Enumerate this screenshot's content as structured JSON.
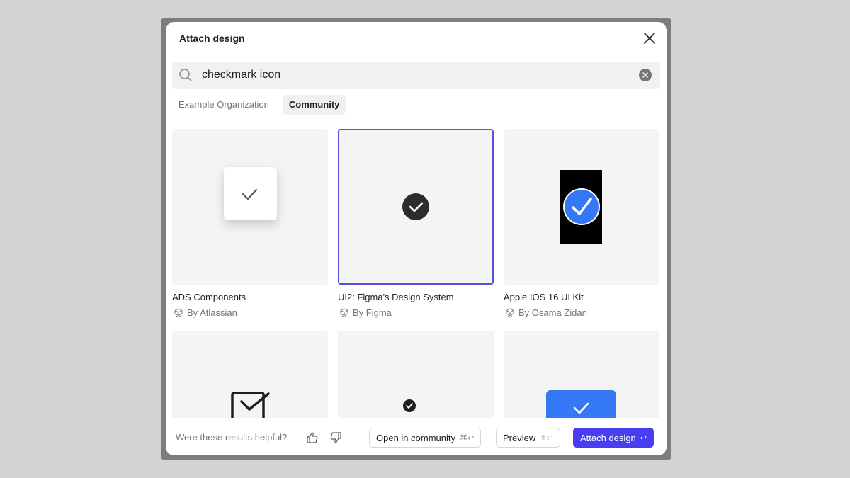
{
  "dialog": {
    "title": "Attach design"
  },
  "search": {
    "value": "checkmark icon",
    "placeholder": "Search"
  },
  "tabs": [
    {
      "label": "Example Organization",
      "active": false
    },
    {
      "label": "Community",
      "active": true
    }
  ],
  "results": [
    {
      "title": "ADS Components",
      "author": "By Atlassian",
      "thumbnail": "white-square-checkmark",
      "selected": false
    },
    {
      "title": "UI2: Figma's Design System",
      "author": "By Figma",
      "thumbnail": "dark-circle-checkmark",
      "selected": true
    },
    {
      "title": "Apple IOS 16 UI Kit",
      "author": "By Osama Zidan",
      "thumbnail": "blue-circle-checkmark-on-black",
      "selected": false
    },
    {
      "title": "",
      "author": "",
      "thumbnail": "outlined-checkbox",
      "selected": false
    },
    {
      "title": "",
      "author": "",
      "thumbnail": "small-dark-circle-checkmark",
      "selected": false
    },
    {
      "title": "",
      "author": "",
      "thumbnail": "blue-square-checkmark",
      "selected": false
    }
  ],
  "footer": {
    "helpful_text": "Were these results helpful?",
    "open_community_label": "Open in community",
    "open_community_shortcut": "⌘↩",
    "preview_label": "Preview",
    "preview_shortcut": "⇧↩",
    "attach_label": "Attach design",
    "attach_shortcut": "↩"
  },
  "colors": {
    "accent": "#4a3df0",
    "selected_border": "#5551de",
    "ios_blue": "#3478f6"
  }
}
